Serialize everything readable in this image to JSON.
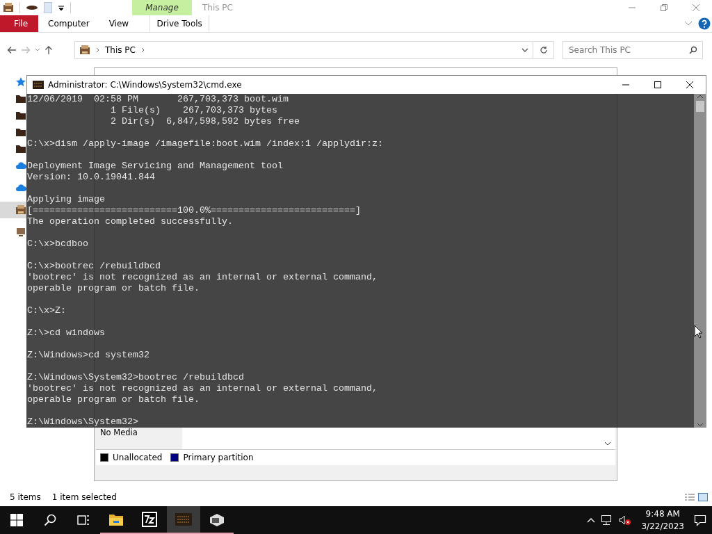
{
  "explorer": {
    "contextual_group": "Manage",
    "title": "This PC",
    "ribbon_tabs": [
      {
        "label": "File",
        "kind": "file"
      },
      {
        "label": "Computer",
        "kind": "normal"
      },
      {
        "label": "View",
        "kind": "normal"
      },
      {
        "label": "Drive Tools",
        "kind": "contextual"
      }
    ],
    "address": {
      "crumbs": [
        "This PC"
      ]
    },
    "search": {
      "placeholder": "Search This PC"
    },
    "sidebar": [
      {
        "kind": "star",
        "selected": false
      },
      {
        "kind": "folder",
        "selected": false
      },
      {
        "kind": "folder",
        "selected": false
      },
      {
        "kind": "folder",
        "selected": false
      },
      {
        "kind": "folder",
        "selected": false
      },
      {
        "kind": "cloud",
        "selected": false
      },
      {
        "kind": "cloud",
        "selected": false
      },
      {
        "kind": "pc",
        "selected": true
      },
      {
        "kind": "network",
        "selected": false
      }
    ],
    "status": {
      "count": "5 items",
      "selection": "1 item selected"
    }
  },
  "disk_management": {
    "disks": [
      {
        "kind": "cdrom",
        "details": [
          "No Media"
        ]
      }
    ],
    "legend": [
      {
        "label": "Unallocated",
        "color": "#000000"
      },
      {
        "label": "Primary partition",
        "color": "#000080"
      }
    ]
  },
  "cmd": {
    "title": "Administrator: C:\\Windows\\System32\\cmd.exe",
    "blocks": [
      [
        "12/06/2019  02:58 PM       267,703,373 boot.wim",
        "               1 File(s)    267,703,373 bytes",
        "               2 Dir(s)  6,847,598,592 bytes free"
      ],
      [
        "C:\\x>dism /apply-image /imagefile:boot.wim /index:1 /applydir:z:"
      ],
      [
        "Deployment Image Servicing and Management tool",
        "Version: 10.0.19041.844"
      ],
      [
        "Applying image",
        "[==========================100.0%==========================]",
        "The operation completed successfully."
      ],
      [
        "C:\\x>bcdboo"
      ],
      [
        "C:\\x>bootrec /rebuildbcd",
        "'bootrec' is not recognized as an internal or external command,",
        "operable program or batch file."
      ],
      [
        "C:\\x>Z:"
      ],
      [
        "Z:\\>cd windows"
      ],
      [
        "Z:\\Windows>cd system32"
      ],
      [
        "Z:\\Windows\\System32>bootrec /rebuildbcd",
        "'bootrec' is not recognized as an internal or external command,",
        "operable program or batch file."
      ],
      [
        "Z:\\Windows\\System32>"
      ]
    ]
  },
  "taskbar": {
    "apps": [
      {
        "kind": "explorer",
        "running": true,
        "focused": false
      },
      {
        "kind": "archiver",
        "running": true,
        "focused": false
      },
      {
        "kind": "console",
        "running": true,
        "focused": true
      },
      {
        "kind": "app",
        "running": true,
        "focused": false
      }
    ],
    "time": "9:48 AM",
    "date": "3/22/2023"
  }
}
